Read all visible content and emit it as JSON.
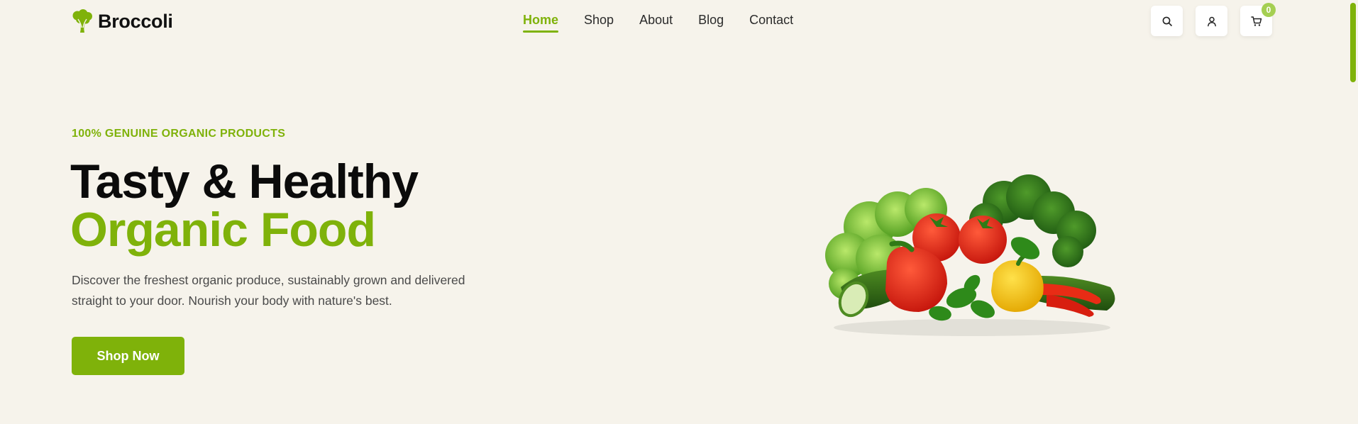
{
  "brand": {
    "name": "Broccoli",
    "logo_icon": "broccoli-icon",
    "accent": "#7fb20a"
  },
  "nav": {
    "items": [
      {
        "label": "Home",
        "active": true
      },
      {
        "label": "Shop",
        "active": false
      },
      {
        "label": "About",
        "active": false
      },
      {
        "label": "Blog",
        "active": false
      },
      {
        "label": "Contact",
        "active": false
      }
    ]
  },
  "actions": {
    "search_icon": "search-icon",
    "account_icon": "user-icon",
    "cart_icon": "cart-icon",
    "cart_count": "0"
  },
  "hero": {
    "tagline": "100% GENUINE ORGANIC PRODUCTS",
    "title_line1": "Tasty & Healthy",
    "title_line2": "Organic Food",
    "description_line1": "Discover the freshest organic produce, sustainably grown and delivered",
    "description_line2": "straight to your door. Nourish your body with nature's best.",
    "cta_label": "Shop Now",
    "image": "vegetables-image"
  },
  "colors": {
    "background": "#f6f3eb",
    "primary": "#7fb20a",
    "badge": "#a5cf52",
    "text": "#0b0b0b"
  }
}
